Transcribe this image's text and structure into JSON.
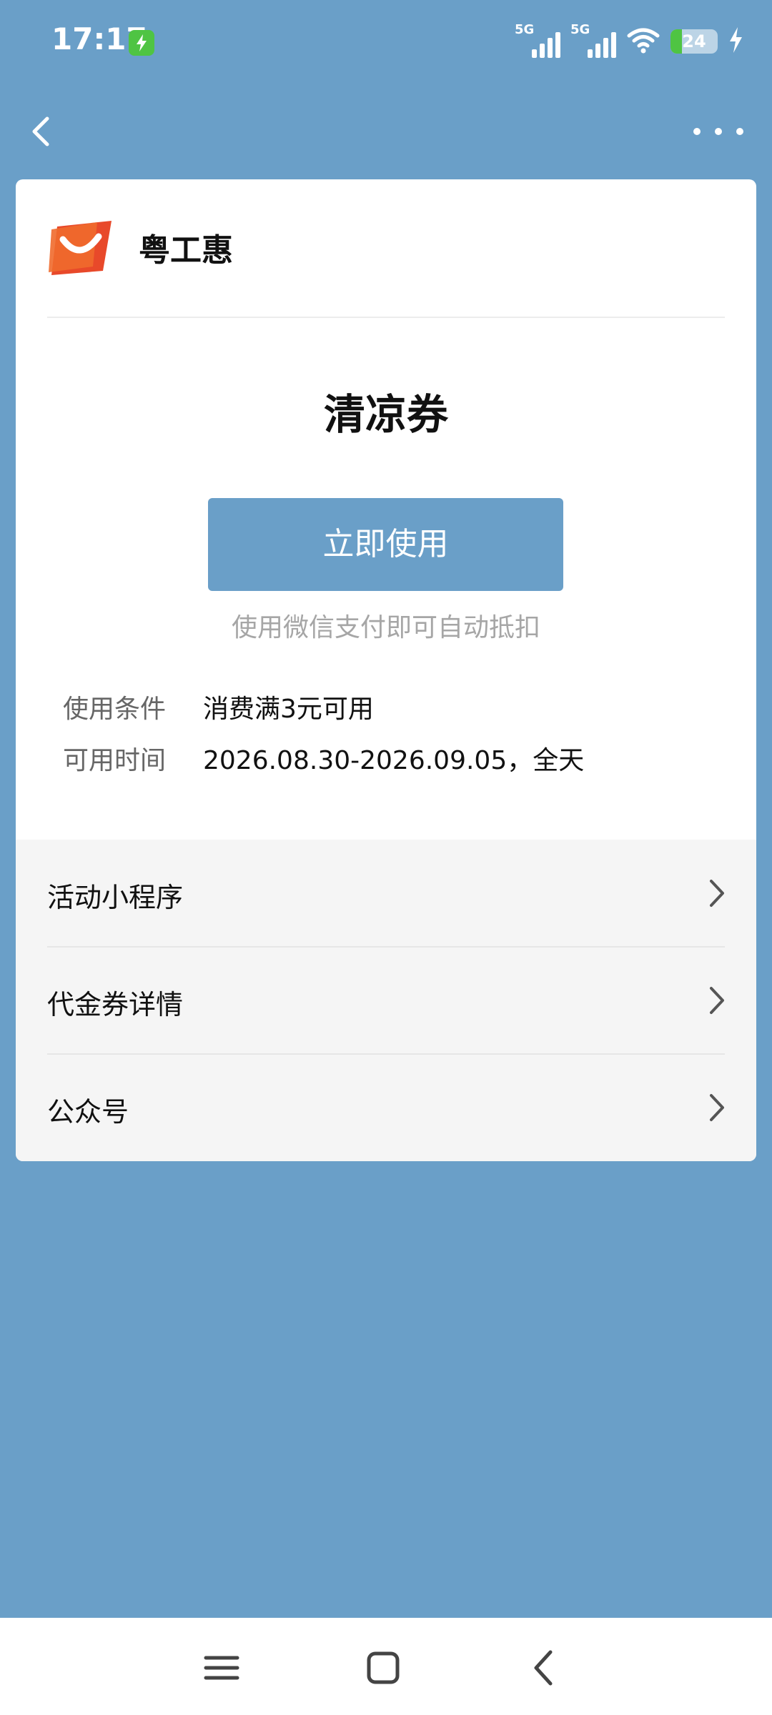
{
  "status_bar": {
    "time": "17:17",
    "signal1_tag": "5G",
    "signal2_tag": "5G",
    "battery_level": "24",
    "icons": [
      "charging-badge-icon",
      "signal-icon",
      "wifi-icon",
      "battery-icon",
      "bolt-icon"
    ]
  },
  "nav": {
    "back_icon": "chevron-left-icon",
    "more_icon": "more-horizontal-icon"
  },
  "merchant": {
    "name": "粤工惠",
    "logo_icon": "merchant-logo"
  },
  "coupon": {
    "title": "清凉券",
    "use_button": "立即使用",
    "hint": "使用微信支付即可自动抵扣",
    "condition_label": "使用条件",
    "condition_value": "消费满3元可用",
    "time_label": "可用时间",
    "time_value": "2026.08.30-2026.09.05，全天"
  },
  "links": [
    {
      "label": "活动小程序"
    },
    {
      "label": "代金券详情"
    },
    {
      "label": "公众号"
    }
  ],
  "system_nav": [
    "menu-icon",
    "home-square-icon",
    "back-triangle-icon"
  ],
  "colors": {
    "accent": "#6a9fc8",
    "card": "#ffffff",
    "links_bg": "#f5f5f5",
    "battery_green": "#4fc443"
  }
}
